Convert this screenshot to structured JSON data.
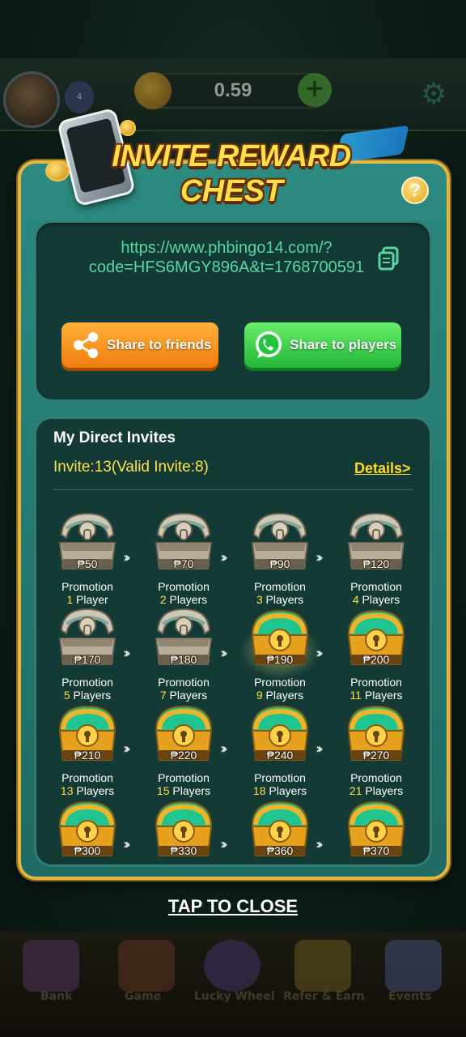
{
  "header": {
    "balance": "0.59",
    "vip_level": "4"
  },
  "modal": {
    "title": "INVITE REWARD CHEST",
    "help_label": "?",
    "invite_link": "https://www.phbingo14.com/?code=HFS6MGY896A&t=1768700591",
    "share_friends_label": "Share to friends",
    "share_players_label": "Share to players"
  },
  "invites": {
    "title": "My Direct Invites",
    "stats": "Invite:13(Valid Invite:8)",
    "details_label": "Details>",
    "chests": [
      {
        "amount": "₱50",
        "caption": "Promotion",
        "count": "1",
        "unit": "Player",
        "state": "opened"
      },
      {
        "amount": "₱70",
        "caption": "Promotion",
        "count": "2",
        "unit": "Players",
        "state": "opened"
      },
      {
        "amount": "₱90",
        "caption": "Promotion",
        "count": "3",
        "unit": "Players",
        "state": "opened"
      },
      {
        "amount": "₱120",
        "caption": "Promotion",
        "count": "4",
        "unit": "Players",
        "state": "opened"
      },
      {
        "amount": "₱170",
        "caption": "Promotion",
        "count": "5",
        "unit": "Players",
        "state": "opened"
      },
      {
        "amount": "₱180",
        "caption": "Promotion",
        "count": "7",
        "unit": "Players",
        "state": "opened"
      },
      {
        "amount": "₱190",
        "caption": "Promotion",
        "count": "9",
        "unit": "Players",
        "state": "claimable"
      },
      {
        "amount": "₱200",
        "caption": "Promotion",
        "count": "11",
        "unit": "Players",
        "state": "locked"
      },
      {
        "amount": "₱210",
        "caption": "Promotion",
        "count": "13",
        "unit": "Players",
        "state": "locked"
      },
      {
        "amount": "₱220",
        "caption": "Promotion",
        "count": "15",
        "unit": "Players",
        "state": "locked"
      },
      {
        "amount": "₱240",
        "caption": "Promotion",
        "count": "18",
        "unit": "Players",
        "state": "locked"
      },
      {
        "amount": "₱270",
        "caption": "Promotion",
        "count": "21",
        "unit": "Players",
        "state": "locked"
      },
      {
        "amount": "₱300",
        "caption": "",
        "count": "",
        "unit": "",
        "state": "locked"
      },
      {
        "amount": "₱330",
        "caption": "",
        "count": "",
        "unit": "",
        "state": "locked"
      },
      {
        "amount": "₱360",
        "caption": "",
        "count": "",
        "unit": "",
        "state": "locked"
      },
      {
        "amount": "₱370",
        "caption": "",
        "count": "",
        "unit": "",
        "state": "locked"
      }
    ]
  },
  "close_label": "TAP TO CLOSE",
  "bottom_nav": [
    "Bank",
    "Game",
    "Lucky Wheel",
    "Refer & Earn",
    "Events"
  ],
  "colors": {
    "modal_bg": "#2c8a80",
    "modal_border": "#e2b743",
    "link": "#58d6a2",
    "highlight": "#ffe14a",
    "share_friends": "#f07d10",
    "share_players": "#23b53a"
  }
}
